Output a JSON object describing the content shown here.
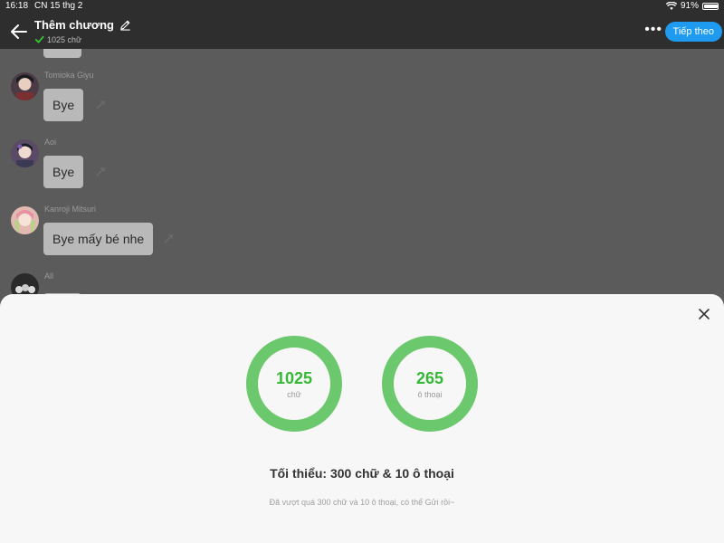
{
  "status_bar": {
    "time": "16:18",
    "date": "CN 15 thg 2",
    "battery": "91%",
    "battery_level": 0.91
  },
  "header": {
    "title": "Thêm chương",
    "word_count": "1025 chữ",
    "follow_button": "Tiếp theo",
    "accent_color": "#1e9bf0"
  },
  "messages": [
    {
      "sender": "Tomioka Giyu",
      "text": "Bye",
      "avatar_color": "#3a2a35"
    },
    {
      "sender": "Aoi",
      "text": "Bye",
      "avatar_color": "#4a3a5a"
    },
    {
      "sender": "Kanroji Mitsuri",
      "text": "Bye mấy bé nhe",
      "avatar_color": "#d9a7a0"
    },
    {
      "sender": "All",
      "text": "",
      "avatar_color": "#2a2a2a"
    }
  ],
  "stats": {
    "words": {
      "value": "1025",
      "unit": "chữ"
    },
    "dialogues": {
      "value": "265",
      "unit": "ô thoại"
    },
    "ring_color": "#6cc86c",
    "value_color": "#36b836"
  },
  "minimum_text": "Tối thiểu: 300 chữ & 10 ô thoại",
  "note_text": "Đã vượt quá 300 chữ và 10 ô thoại, có thể Gửi rồi~"
}
